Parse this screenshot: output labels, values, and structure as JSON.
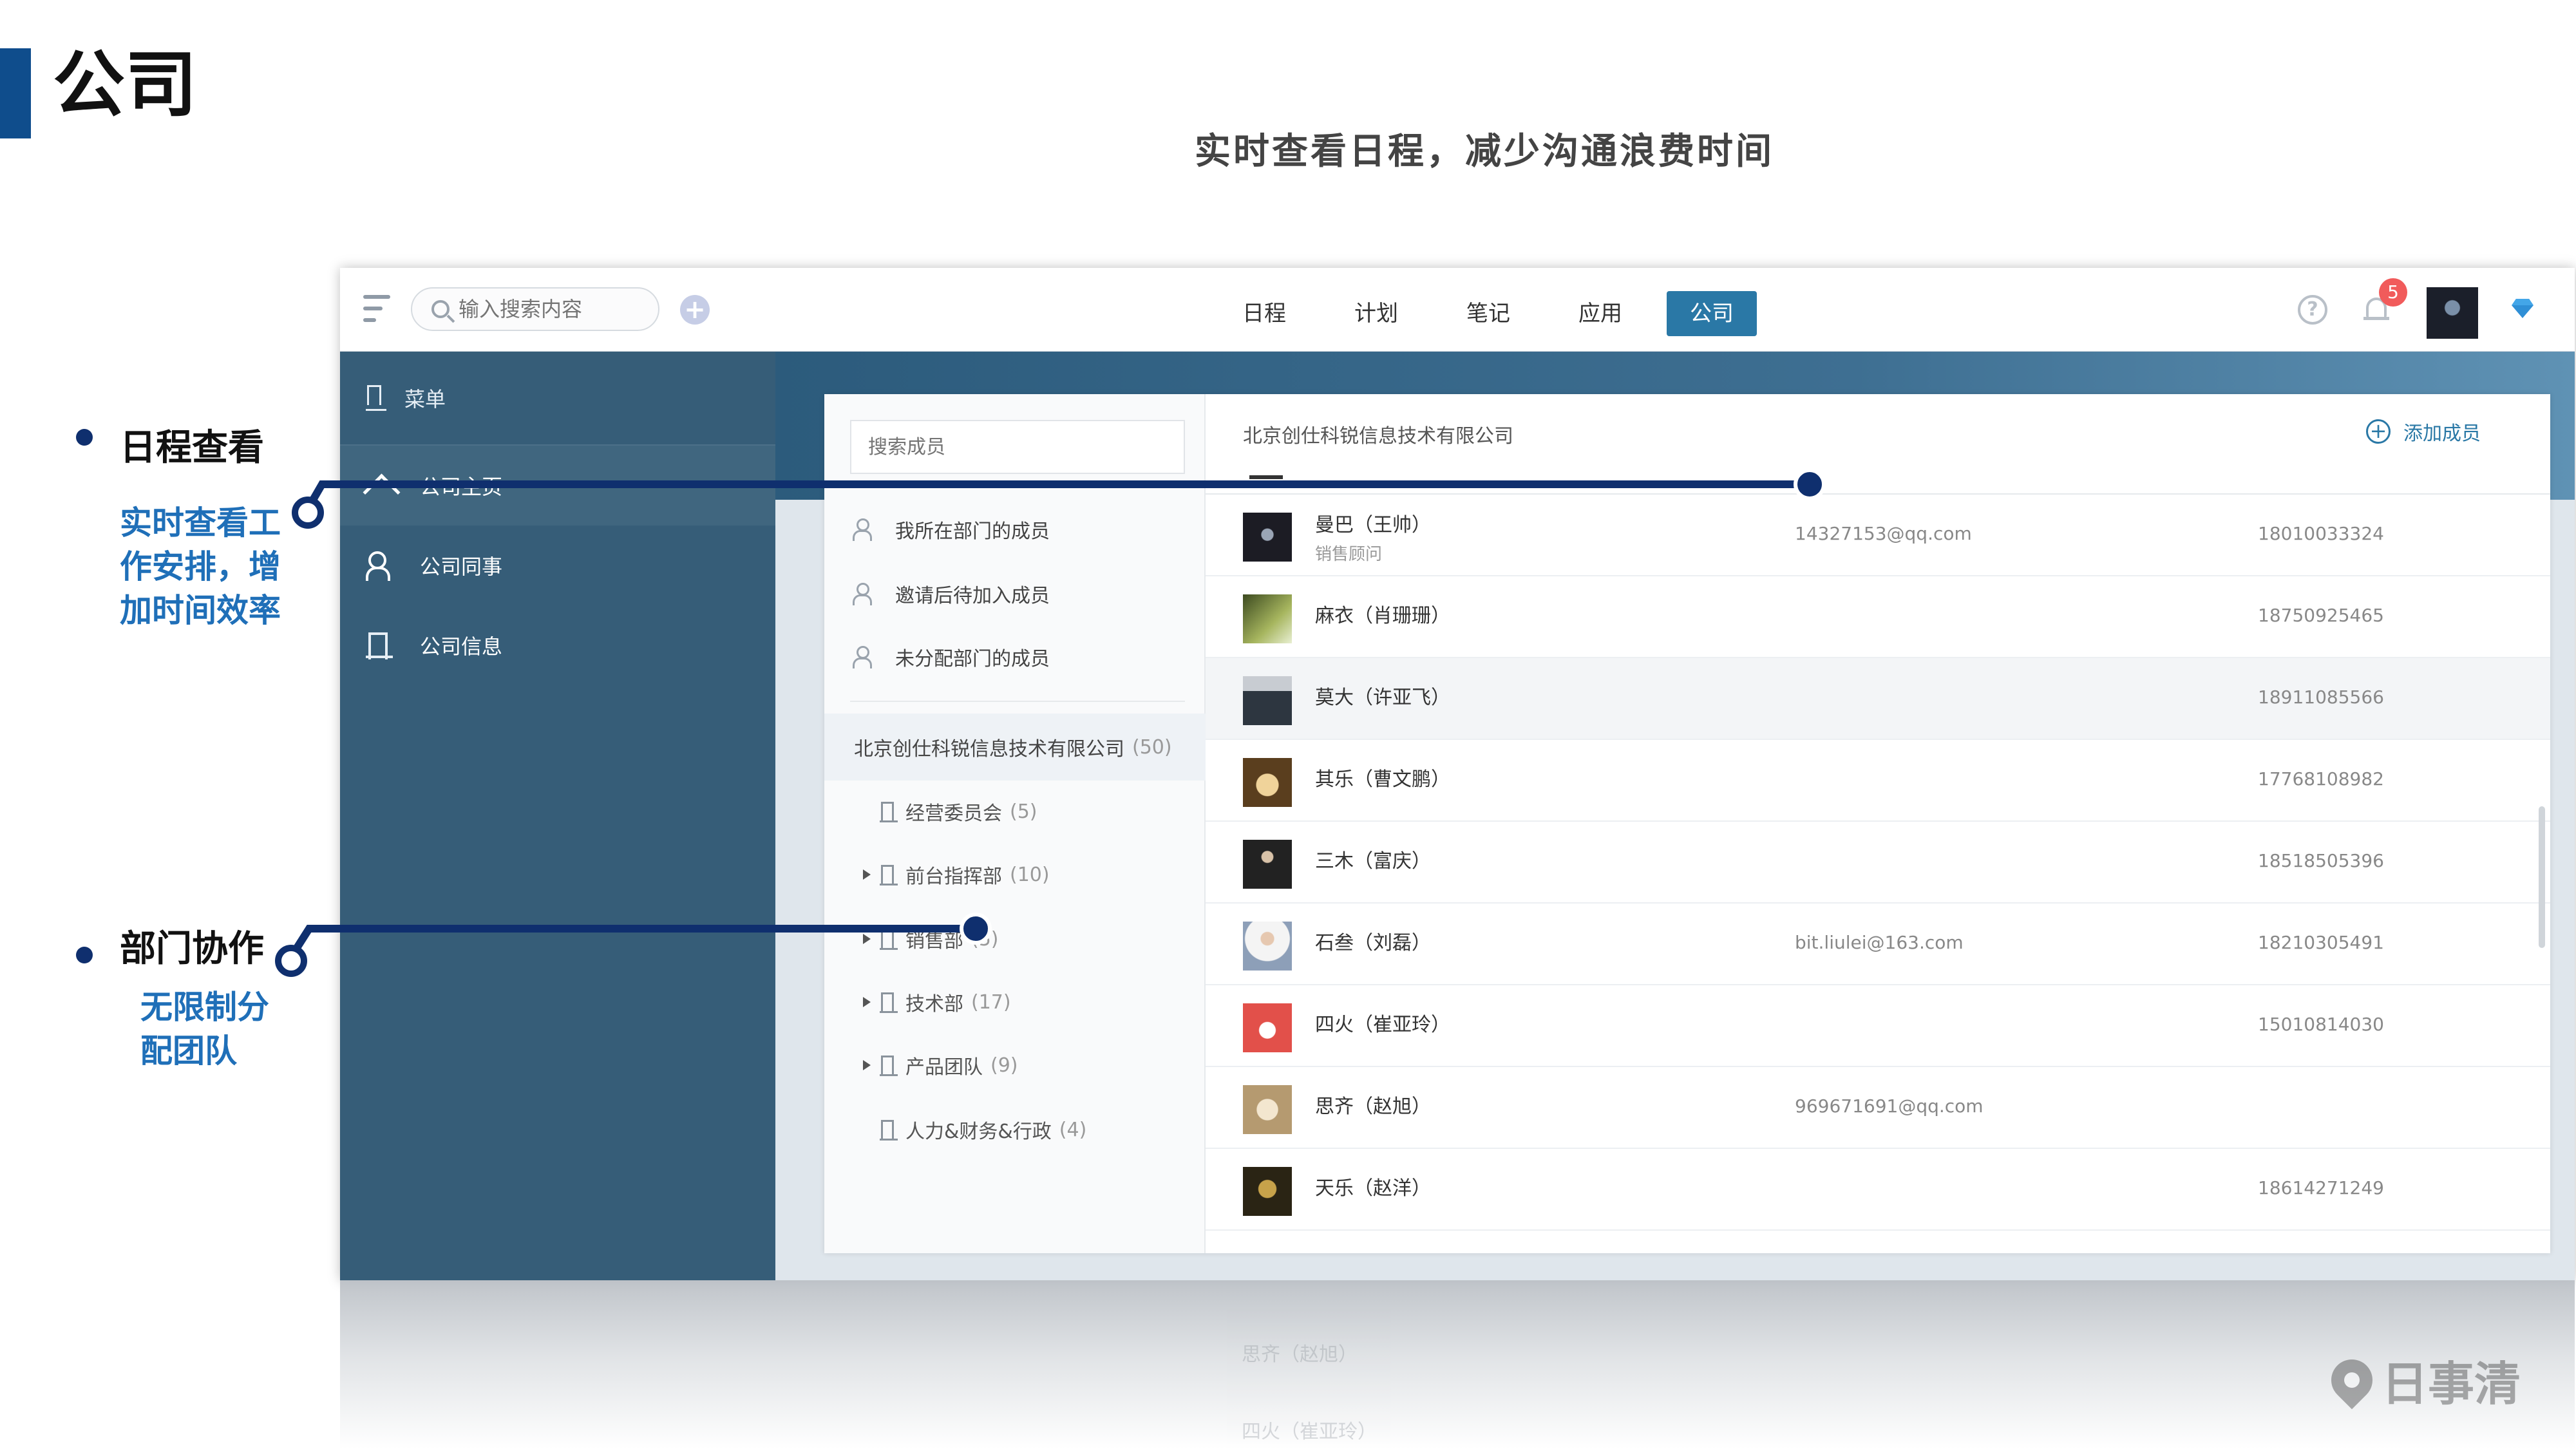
{
  "slide": {
    "title": "公司",
    "subtitle": "实时查看日程，减少沟通浪费时间",
    "features": [
      {
        "title": "日程查看",
        "desc": "实时查看工作安排，增加时间效率"
      },
      {
        "title": "部门协作",
        "desc": "无限制分配团队"
      }
    ]
  },
  "topbar": {
    "search_placeholder": "输入搜索内容",
    "tabs": [
      {
        "label": "日程",
        "active": false
      },
      {
        "label": "计划",
        "active": false
      },
      {
        "label": "笔记",
        "active": false
      },
      {
        "label": "应用",
        "active": false
      },
      {
        "label": "公司",
        "active": true
      }
    ],
    "notification_count": "5",
    "help_glyph": "?",
    "add_glyph": "+"
  },
  "sidebar": {
    "header": "菜单",
    "items": [
      {
        "label": "公司主页",
        "icon": "home-icon",
        "active": true
      },
      {
        "label": "公司同事",
        "icon": "people-icon",
        "active": false
      },
      {
        "label": "公司信息",
        "icon": "building-icon",
        "active": false
      }
    ]
  },
  "members_panel": {
    "search_placeholder": "搜索成员",
    "categories": [
      {
        "label": "我所在部门的成员"
      },
      {
        "label": "邀请后待加入成员"
      },
      {
        "label": "未分配部门的成员"
      }
    ],
    "company": {
      "name": "北京创仕科锐信息技术有限公司",
      "count": "(50)"
    },
    "departments": [
      {
        "name": "经营委员会",
        "count": "(5)",
        "expandable": false
      },
      {
        "name": "前台指挥部",
        "count": "(10)",
        "expandable": true
      },
      {
        "name": "销售部",
        "count": "(5)",
        "expandable": true
      },
      {
        "name": "技术部",
        "count": "(17)",
        "expandable": true
      },
      {
        "name": "产品团队",
        "count": "(9)",
        "expandable": true
      },
      {
        "name": "人力&财务&行政",
        "count": "(4)",
        "expandable": false
      }
    ],
    "list_title": "北京创仕科锐信息技术有限公司",
    "add_member_label": "添加成员",
    "members": [
      {
        "name": "曼巴（王帅）",
        "role": "销售顾问",
        "email": "14327153@qq.com",
        "phone": "18010033324",
        "avatar_color": "#1c1c24"
      },
      {
        "name": "麻衣（肖珊珊）",
        "role": "",
        "email": "",
        "phone": "18750925465",
        "avatar_color": "#6f7f3a"
      },
      {
        "name": "莫大（许亚飞）",
        "role": "",
        "email": "",
        "phone": "18911085566",
        "avatar_color": "#4b5560"
      },
      {
        "name": "其乐（曹文鹏）",
        "role": "",
        "email": "",
        "phone": "17768108982",
        "avatar_color": "#8a6a3a"
      },
      {
        "name": "三木（富庆）",
        "role": "",
        "email": "",
        "phone": "18518505396",
        "avatar_color": "#2a2a2a"
      },
      {
        "name": "石叁（刘磊）",
        "role": "",
        "email": "bit.liulei@163.com",
        "phone": "18210305491",
        "avatar_color": "#d9c2b0"
      },
      {
        "name": "四火（崔亚玲）",
        "role": "",
        "email": "",
        "phone": "15010814030",
        "avatar_color": "#e2504a"
      },
      {
        "name": "思齐（赵旭）",
        "role": "",
        "email": "969671691@qq.com",
        "phone": "",
        "avatar_color": "#b59a70"
      },
      {
        "name": "天乐（赵洋）",
        "role": "",
        "email": "",
        "phone": "18614271249",
        "avatar_color": "#3a3220"
      }
    ]
  },
  "logo": {
    "text": "日事清"
  },
  "colors": {
    "accent": "#2a78a6",
    "sidebar": "#365d78",
    "callout": "#0f2f6e",
    "highlight_text": "#1f6fb8"
  }
}
